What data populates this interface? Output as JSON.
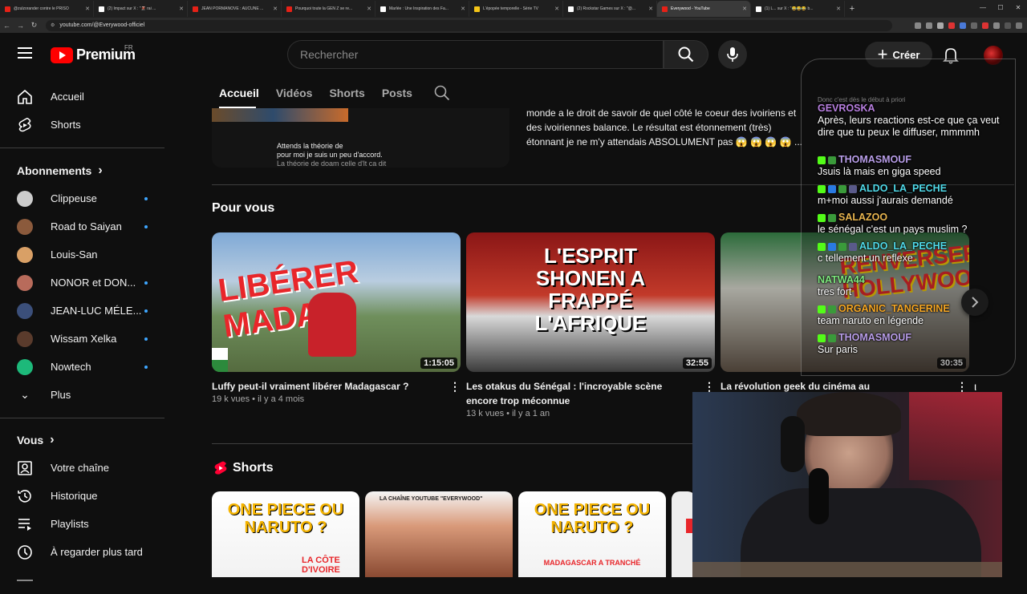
{
  "browser": {
    "tabs": [
      {
        "title": "@zulzorander contre le PRISO",
        "color": "#e62117",
        "active": false
      },
      {
        "title": "(2) Impact sur X : \"🌋 rai ...",
        "color": "#ffffff",
        "active": false
      },
      {
        "title": "JEAN PORMANOVE : AUCUNE ...",
        "color": "#e62117",
        "active": false
      },
      {
        "title": "Pourquoi toute la GEN Z se re...",
        "color": "#e62117",
        "active": false
      },
      {
        "title": "Marlée : Une Inspiration des Fa...",
        "color": "#ffffff",
        "active": false
      },
      {
        "title": "L'épopée temporelle - Série TV",
        "color": "#f5c518",
        "active": false
      },
      {
        "title": "(2) Rockstar Games sur X : \"@...",
        "color": "#ffffff",
        "active": false
      },
      {
        "title": "Everywood - YouTube",
        "color": "#e62117",
        "active": true
      },
      {
        "title": "(1) L... sur X : \"😂😂😂 b...",
        "color": "#ffffff",
        "active": false
      }
    ],
    "new_tab": "+",
    "url": "youtube.com/@Everywood-officiel"
  },
  "masthead": {
    "logo_text": "Premium",
    "region": "FR",
    "search_placeholder": "Rechercher",
    "create_label": "Créer"
  },
  "sidebar": {
    "main_items": [
      {
        "label": "Accueil",
        "icon": "home-icon"
      },
      {
        "label": "Shorts",
        "icon": "shorts-icon"
      }
    ],
    "subscriptions_title": "Abonnements",
    "subscriptions": [
      {
        "name": "Clippeuse",
        "dot": true,
        "color": "#cccccc"
      },
      {
        "name": "Road to Saiyan",
        "dot": true,
        "color": "#8b5a3c"
      },
      {
        "name": "Louis-San",
        "dot": false,
        "color": "#d9a066"
      },
      {
        "name": "NONOR et DON...",
        "dot": true,
        "color": "#b86b5b"
      },
      {
        "name": "JEAN-LUC MÉLE...",
        "dot": true,
        "color": "#3b4f7a"
      },
      {
        "name": "Wissam Xelka",
        "dot": true,
        "color": "#5a3b2c"
      },
      {
        "name": "Nowtech",
        "dot": true,
        "color": "#1db97a"
      }
    ],
    "more_label": "Plus",
    "you_title": "Vous",
    "you_items": [
      {
        "label": "Votre chaîne",
        "icon": "channel-icon"
      },
      {
        "label": "Historique",
        "icon": "history-icon"
      },
      {
        "label": "Playlists",
        "icon": "playlists-icon"
      },
      {
        "label": "À regarder plus tard",
        "icon": "watch-later-icon"
      }
    ]
  },
  "channel_tabs": [
    "Accueil",
    "Vidéos",
    "Shorts",
    "Posts"
  ],
  "featured": {
    "subtitle_line1": "Attends la théorie de",
    "subtitle_line2": "pour moi je suis un peu d'accord.",
    "subtitle_line3": "La théorie de doam celle d'lt ca dit",
    "description": "monde a le droit de savoir de quel côté le coeur des ivoiriens et des ivoiriennes balance. Le résultat est étonnement (très) étonnant je ne m'y attendais ABSOLUMENT pas 😱 😱 😱 😱 ..."
  },
  "for_you": {
    "title": "Pour vous",
    "videos": [
      {
        "title": "Luffy peut-il vraiment libérer Madagascar ?",
        "views": "19 k vues",
        "age": "il y a 4 mois",
        "duration": "1:15:05",
        "overlay": "LIBÉRER MADA?"
      },
      {
        "title": "Les otakus du Sénégal : l'incroyable scène encore trop méconnue",
        "views": "13 k vues",
        "age": "il y a 1 an",
        "duration": "32:55",
        "overlay": "L'ESPRIT SHONEN A FRAPPÉ L'AFRIQUE"
      },
      {
        "title": "La révolution geek du cinéma au Sénégal -",
        "views": "",
        "age": "",
        "duration": "30:35",
        "overlay": "RENVERSER HOLLYWOOD"
      }
    ]
  },
  "shorts": {
    "title": "Shorts",
    "items": [
      {
        "overlay": "ONE PIECE OU NARUTO ?",
        "caption": "LA CÔTE D'IVOIRE"
      },
      {
        "overlay": "LA CHAÎNE YOUTUBE \"EVERYWOOD\"",
        "caption": ""
      },
      {
        "overlay": "ONE PIECE OU NARUTO ?",
        "caption": "MADAGASCAR A TRANCHÉ"
      }
    ]
  },
  "chat": {
    "ghost": "Donc c'est dès le début à priori",
    "messages": [
      {
        "user": "GEVROSKA",
        "color": "#b87fe0",
        "text": "Après, leurs reactions est-ce que ça veut dire que tu peux le diffuser, mmmmh",
        "badges": []
      },
      {
        "user": "THOMASMOUF",
        "color": "#b89de8",
        "text": "Jsuis là mais en giga speed",
        "badges": [
          "#53fc18",
          "#3a9a3a"
        ]
      },
      {
        "user": "ALDO_LA_PECHE",
        "color": "#4fd9e8",
        "text": "m+moi aussi j'aurais demandé",
        "badges": [
          "#53fc18",
          "#2a7ae2",
          "#3a9a3a",
          "#5a5a8a"
        ]
      },
      {
        "user": "SALAZOO",
        "color": "#e8b54f",
        "text": "le sénégal c'est un pays muslim ?",
        "badges": [
          "#53fc18",
          "#3a9a3a"
        ]
      },
      {
        "user": "ALDO_LA_PECHE",
        "color": "#4fd9e8",
        "text": "c tellement un reflexe",
        "badges": [
          "#53fc18",
          "#2a7ae2",
          "#3a9a3a",
          "#5a5a8a"
        ]
      },
      {
        "user": "NATWA44",
        "color": "#7ee87e",
        "text": "tres fort",
        "badges": []
      },
      {
        "user": "ORGANIC_TANGERINE",
        "color": "#f5a623",
        "text": "team naruto en légende",
        "badges": [
          "#53fc18",
          "#3a9a3a"
        ]
      },
      {
        "user": "THOMASMOUF",
        "color": "#b89de8",
        "text": "Sur paris",
        "badges": [
          "#53fc18",
          "#3a9a3a"
        ]
      }
    ]
  },
  "colors": {
    "brand": "#ff0000",
    "accent": "#3ea6ff",
    "bg": "#0f0f0f"
  }
}
